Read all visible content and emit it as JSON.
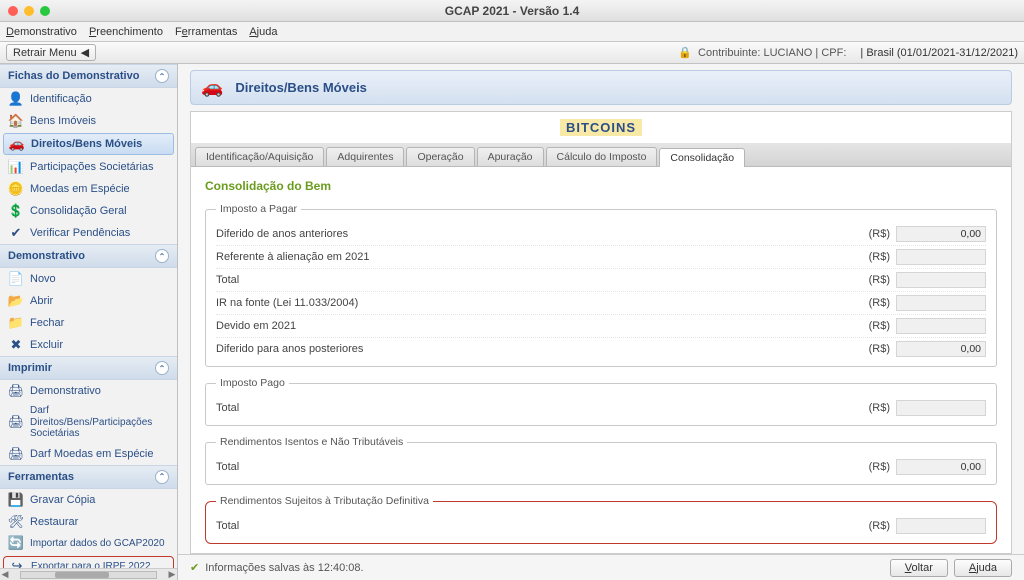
{
  "window": {
    "title": "GCAP 2021 - Versão 1.4"
  },
  "menubar": [
    "Demonstrativo",
    "Preenchimento",
    "Ferramentas",
    "Ajuda"
  ],
  "toolbar": {
    "retrair": "Retrair Menu",
    "contribuinte_label": "Contribuinte:",
    "contribuinte_nome": "LUCIANO",
    "cpf_label": "CPF:",
    "periodo": "Brasil (01/01/2021-31/12/2021)"
  },
  "sidebar": {
    "groups": [
      {
        "title": "Fichas do Demonstrativo",
        "items": [
          {
            "icon": "👤",
            "label": "Identificação"
          },
          {
            "icon": "🏠",
            "label": "Bens Imóveis"
          },
          {
            "icon": "🚗",
            "label": "Direitos/Bens Móveis",
            "active": true
          },
          {
            "icon": "📊",
            "label": "Participações Societárias"
          },
          {
            "icon": "🪙",
            "label": "Moedas em Espécie"
          },
          {
            "icon": "💲",
            "label": "Consolidação Geral"
          },
          {
            "icon": "✔",
            "label": "Verificar Pendências"
          }
        ]
      },
      {
        "title": "Demonstrativo",
        "items": [
          {
            "icon": "📄",
            "label": "Novo"
          },
          {
            "icon": "📂",
            "label": "Abrir"
          },
          {
            "icon": "📁",
            "label": "Fechar"
          },
          {
            "icon": "✖",
            "label": "Excluir"
          }
        ]
      },
      {
        "title": "Imprimir",
        "items": [
          {
            "icon": "🖨",
            "label": "Demonstrativo"
          },
          {
            "icon": "🖨",
            "label": "Darf Direitos/Bens/Participações Societárias",
            "small": true
          },
          {
            "icon": "🖨",
            "label": "Darf Moedas em Espécie"
          }
        ]
      },
      {
        "title": "Ferramentas",
        "items": [
          {
            "icon": "💾",
            "label": "Gravar Cópia"
          },
          {
            "icon": "🛠",
            "label": "Restaurar"
          },
          {
            "icon": "🔄",
            "label": "Importar dados do GCAP2020",
            "small": true
          },
          {
            "icon": "↪",
            "label": "Exportar para o IRPF 2022",
            "small": true,
            "boxed": true
          }
        ]
      }
    ]
  },
  "page": {
    "header_title": "Direitos/Bens Móveis",
    "record_name": "BITCOINS",
    "tabs": [
      "Identificação/Aquisição",
      "Adquirentes",
      "Operação",
      "Apuração",
      "Cálculo do Imposto",
      "Consolidação"
    ],
    "active_tab": 5,
    "section_title": "Consolidação do Bem",
    "currency": "(R$)",
    "groups": [
      {
        "legend": "Imposto a Pagar",
        "rows": [
          {
            "label": "Diferido de anos anteriores",
            "value": "0,00"
          },
          {
            "label": "Referente à  alienação em 2021",
            "value": ""
          },
          {
            "label": "Total",
            "value": ""
          },
          {
            "label": "IR na fonte (Lei 11.033/2004)",
            "value": ""
          },
          {
            "label": "Devido em 2021",
            "value": ""
          },
          {
            "label": "Diferido para anos posteriores",
            "value": "0,00"
          }
        ]
      },
      {
        "legend": "Imposto Pago",
        "rows": [
          {
            "label": "Total",
            "value": ""
          }
        ]
      },
      {
        "legend": "Rendimentos Isentos e Não Tributáveis",
        "rows": [
          {
            "label": "Total",
            "value": "0,00"
          }
        ]
      },
      {
        "legend": "Rendimentos Sujeitos à Tributação Definitiva",
        "highlight": true,
        "rows": [
          {
            "label": "Total",
            "value": ""
          }
        ]
      }
    ]
  },
  "footer": {
    "status": "Informações salvas às 12:40:08.",
    "btn_voltar": "Voltar",
    "btn_ajuda": "Ajuda"
  }
}
